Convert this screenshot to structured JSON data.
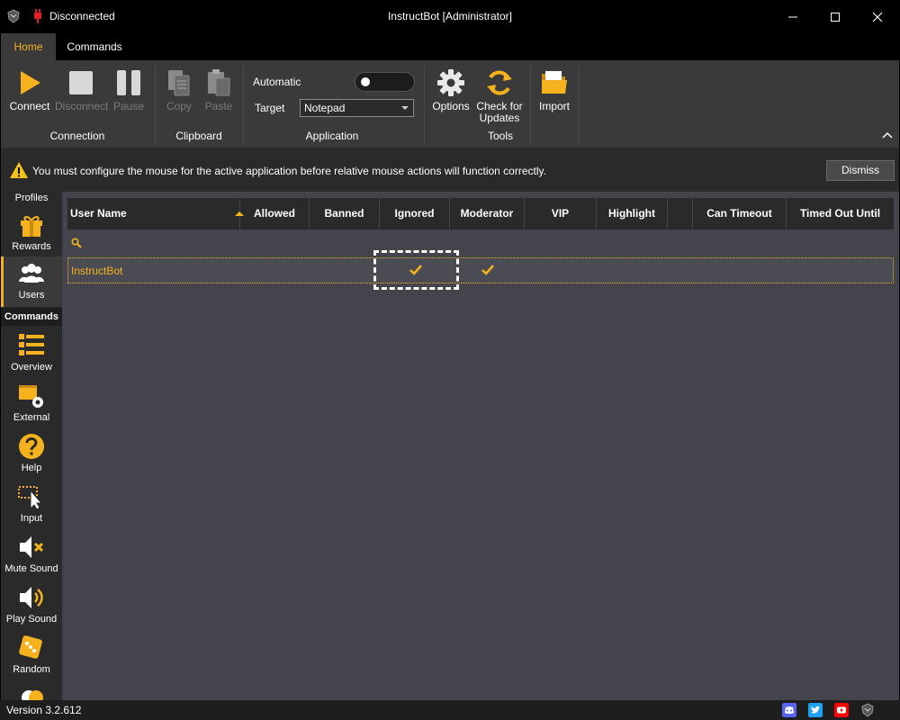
{
  "titlebar": {
    "connection_status": "Disconnected",
    "title": "InstructBot [Administrator]"
  },
  "tabs": [
    {
      "label": "Home",
      "active": true
    },
    {
      "label": "Commands",
      "active": false
    }
  ],
  "ribbon": {
    "buttons": {
      "connect": "Connect",
      "disconnect": "Disconnect",
      "pause": "Pause",
      "copy": "Copy",
      "paste": "Paste",
      "options": "Options",
      "check_updates_1": "Check for",
      "check_updates_2": "Updates",
      "import": "Import"
    },
    "groups": {
      "connection": "Connection",
      "clipboard": "Clipboard",
      "application": "Application",
      "tools": "Tools"
    },
    "application": {
      "automatic_label": "Automatic",
      "automatic_on": false,
      "target_label": "Target",
      "target_value": "Notepad"
    }
  },
  "warning": {
    "message": "You must configure the mouse for the active application before relative mouse actions will function correctly.",
    "dismiss_label": "Dismiss"
  },
  "sidebar": {
    "items_top": [
      {
        "label": "Profiles",
        "icon": "profiles-icon"
      },
      {
        "label": "Rewards",
        "icon": "gift-icon"
      },
      {
        "label": "Users",
        "icon": "users-icon",
        "active": true
      }
    ],
    "section_header": "Commands",
    "items": [
      {
        "label": "Overview",
        "icon": "overview-icon"
      },
      {
        "label": "External",
        "icon": "external-icon"
      },
      {
        "label": "Help",
        "icon": "help-icon"
      },
      {
        "label": "Input",
        "icon": "input-icon"
      },
      {
        "label": "Mute Sound",
        "icon": "mute-sound-icon"
      },
      {
        "label": "Play Sound",
        "icon": "play-sound-icon"
      },
      {
        "label": "Random",
        "icon": "dice-icon"
      }
    ]
  },
  "grid": {
    "columns": [
      "User Name",
      "Allowed",
      "Banned",
      "Ignored",
      "Moderator",
      "VIP",
      "Highlight",
      "",
      "Can Timeout",
      "Timed Out Until"
    ],
    "rows": [
      {
        "user": "InstructBot",
        "allowed": false,
        "banned": false,
        "ignored": true,
        "moderator": true,
        "vip": false,
        "highlight": false,
        "can_timeout": false,
        "timed_out_until": ""
      }
    ]
  },
  "statusbar": {
    "version": "Version 3.2.612"
  },
  "colors": {
    "accent": "#f5b21c",
    "discord": "#5865f2",
    "twitter": "#1da1f2",
    "youtube": "#ff0000"
  }
}
